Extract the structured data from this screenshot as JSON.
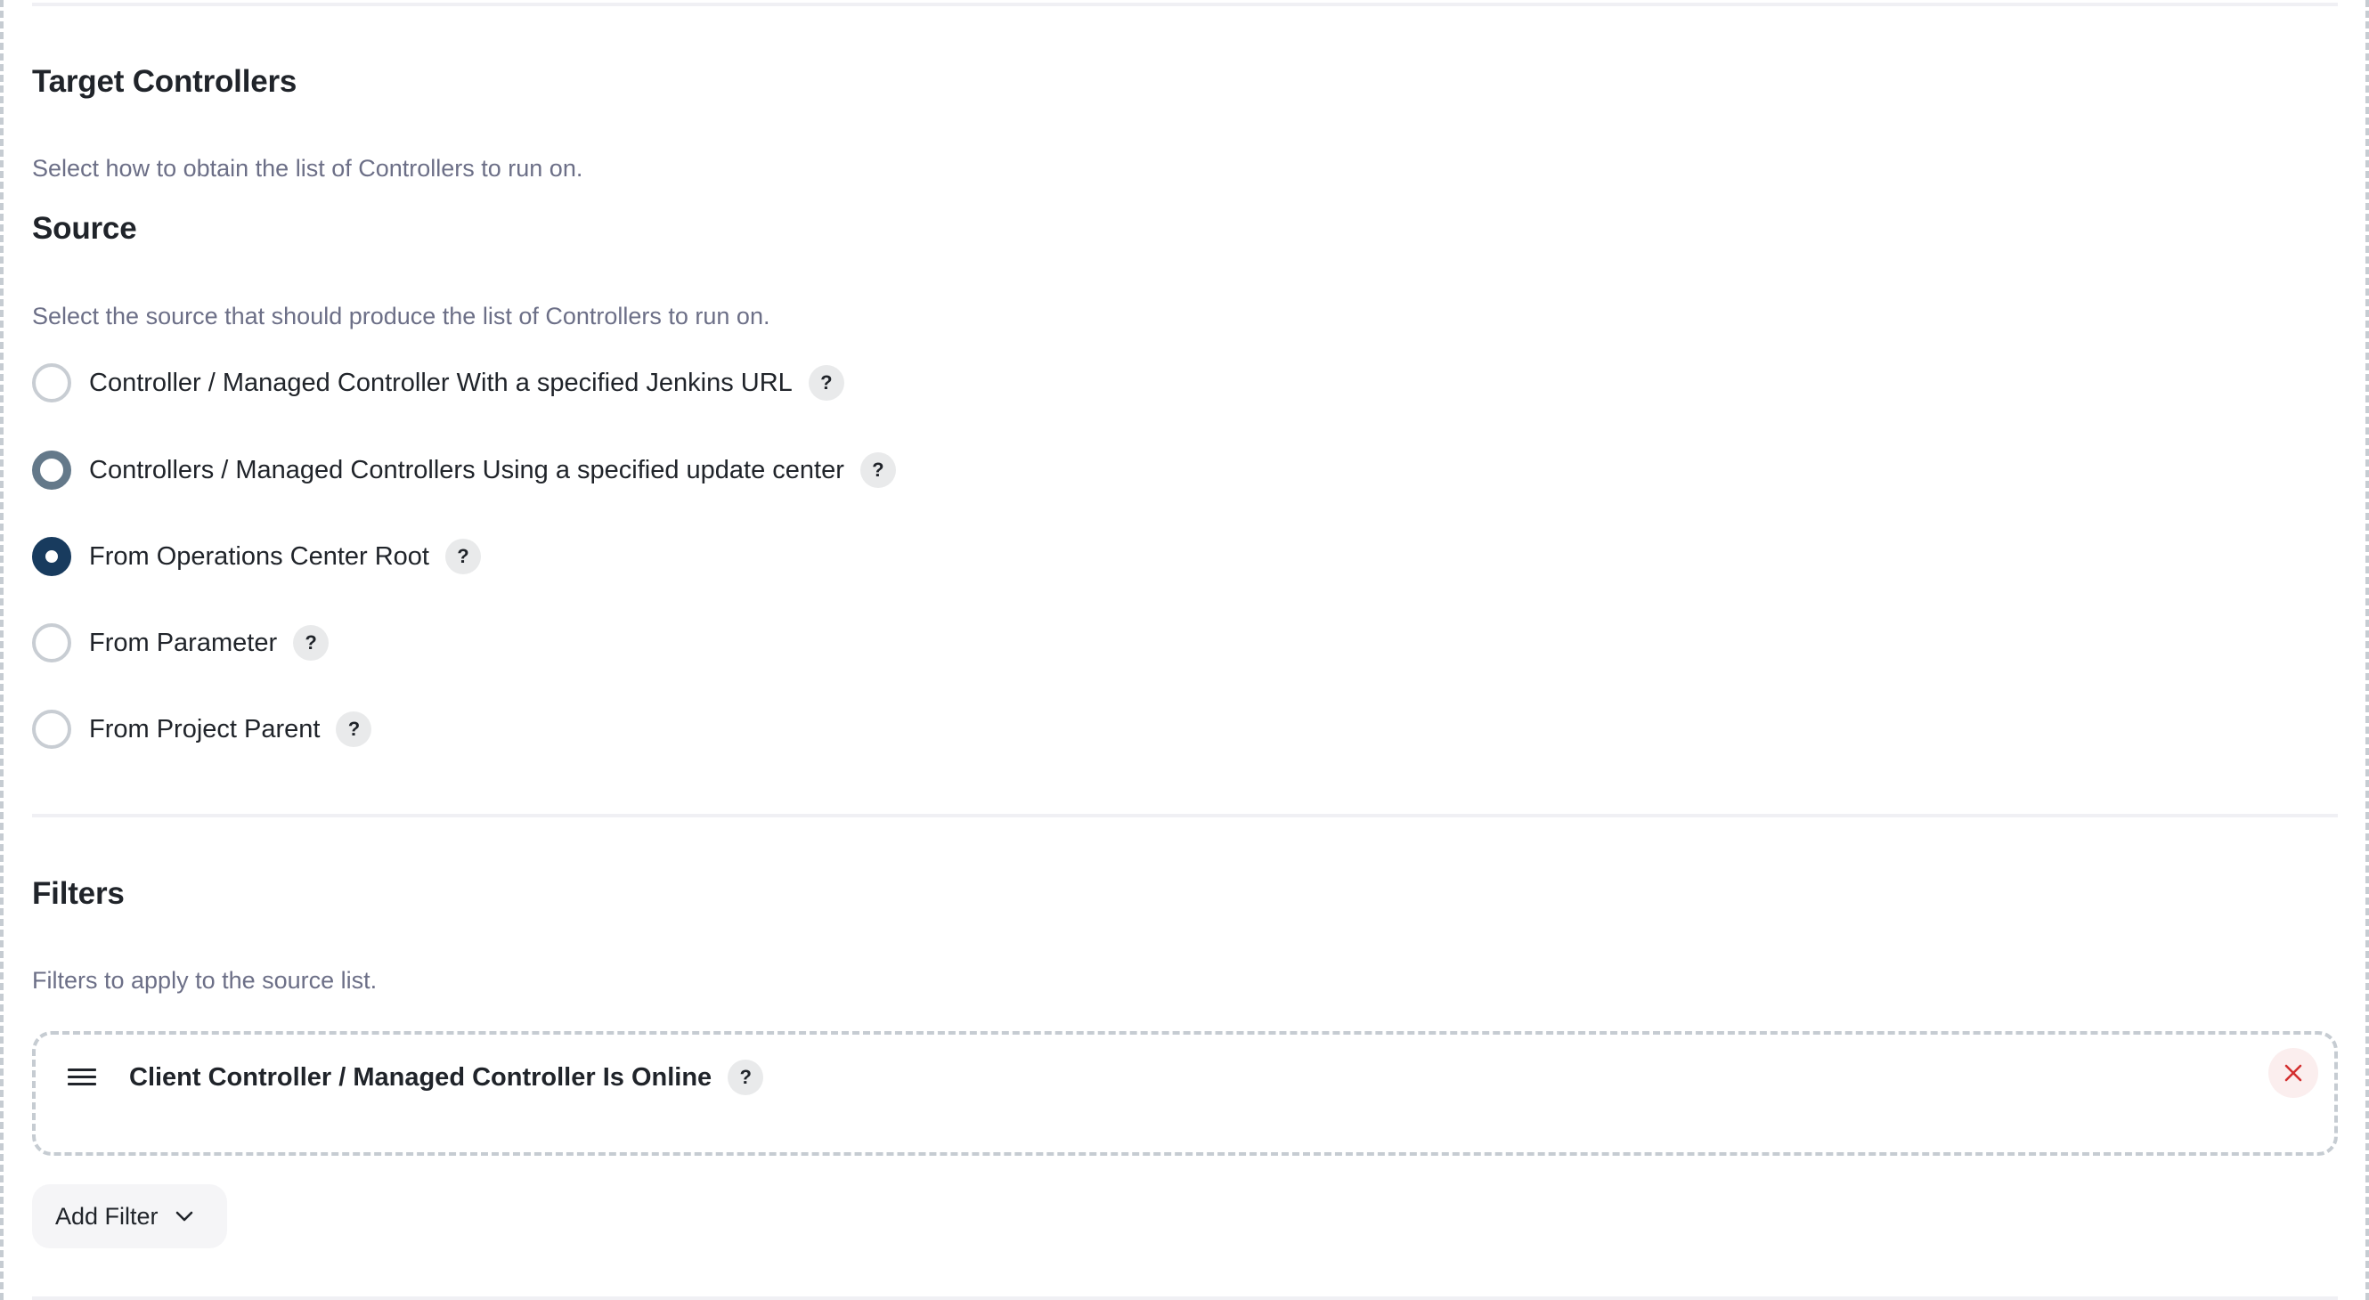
{
  "target_controllers": {
    "title": "Target Controllers",
    "description": "Select how to obtain the list of Controllers to run on."
  },
  "source": {
    "title": "Source",
    "description": "Select the source that should produce the list of Controllers to run on.",
    "selected_index": 2,
    "hovered_index": 1,
    "options": [
      {
        "label": "Controller / Managed Controller With a specified Jenkins URL",
        "help": "?"
      },
      {
        "label": "Controllers / Managed Controllers Using a specified update center",
        "help": "?"
      },
      {
        "label": "From Operations Center Root",
        "help": "?"
      },
      {
        "label": "From Parameter",
        "help": "?"
      },
      {
        "label": "From Project Parent",
        "help": "?"
      }
    ]
  },
  "filters": {
    "title": "Filters",
    "description": "Filters to apply to the source list.",
    "items": [
      {
        "title": "Client Controller / Managed Controller Is Online",
        "help": "?",
        "drag_icon": "drag-handle-icon",
        "remove_icon": "close-icon"
      }
    ],
    "add_button_label": "Add Filter",
    "add_button_icon": "chevron-down-icon"
  },
  "colors": {
    "radio_selected": "#183b5e",
    "radio_hover": "#64798a",
    "radio_unselected": "#c8cdd3",
    "remove_icon": "#d32f2f",
    "remove_bg": "#fbeeee",
    "help_bg": "#e9eaeb",
    "description_text": "#6c6f87",
    "heading_text": "#20242a"
  }
}
